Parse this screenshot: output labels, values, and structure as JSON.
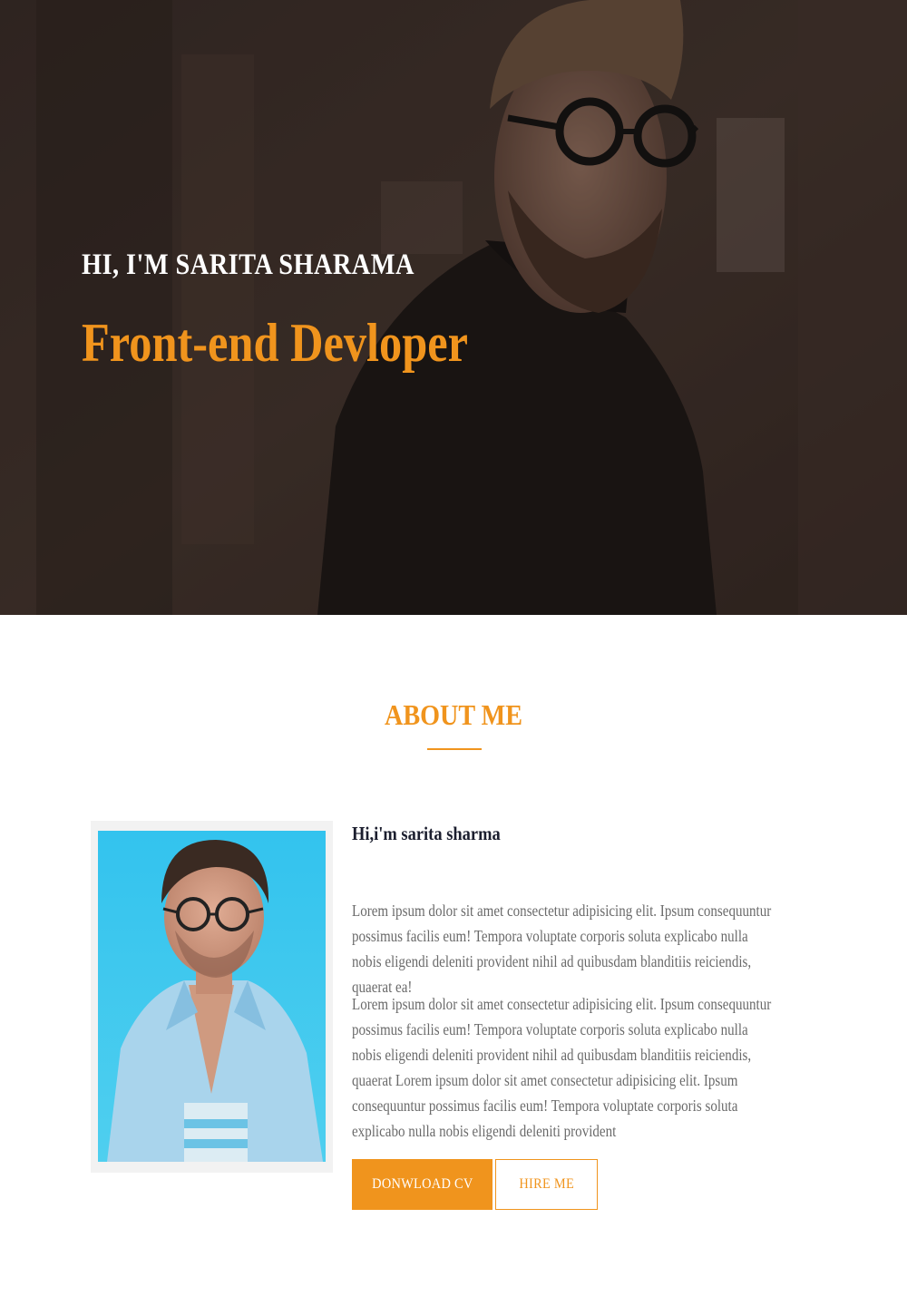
{
  "hero": {
    "greeting": "HI, I'M SARITA SHARAMA",
    "role": "Front-end Devloper"
  },
  "about": {
    "title": "ABOUT ME",
    "name": "Hi,i'm sarita sharma",
    "paragraphs": [
      "Lorem ipsum dolor sit amet consectetur adipisicing elit. Ipsum consequuntur possimus facilis eum! Tempora voluptate corporis soluta explicabo nulla nobis eligendi deleniti provident nihil ad quibusdam blanditiis reiciendis, quaerat ea!",
      "Lorem ipsum dolor sit amet consectetur adipisicing elit. Ipsum consequuntur possimus facilis eum! Tempora voluptate corporis soluta explicabo nulla nobis eligendi deleniti provident nihil ad quibusdam blanditiis reiciendis, quaerat Lorem ipsum dolor sit amet consectetur adipisicing elit. Ipsum consequuntur possimus facilis eum! Tempora voluptate corporis soluta explicabo nulla nobis eligendi deleniti provident"
    ],
    "buttons": {
      "download": "DONWLOAD CV",
      "hire": "HIRE ME"
    }
  },
  "colors": {
    "accent": "#f0941d",
    "text": "#6a6a6a",
    "heading": "#1b1e2e"
  }
}
